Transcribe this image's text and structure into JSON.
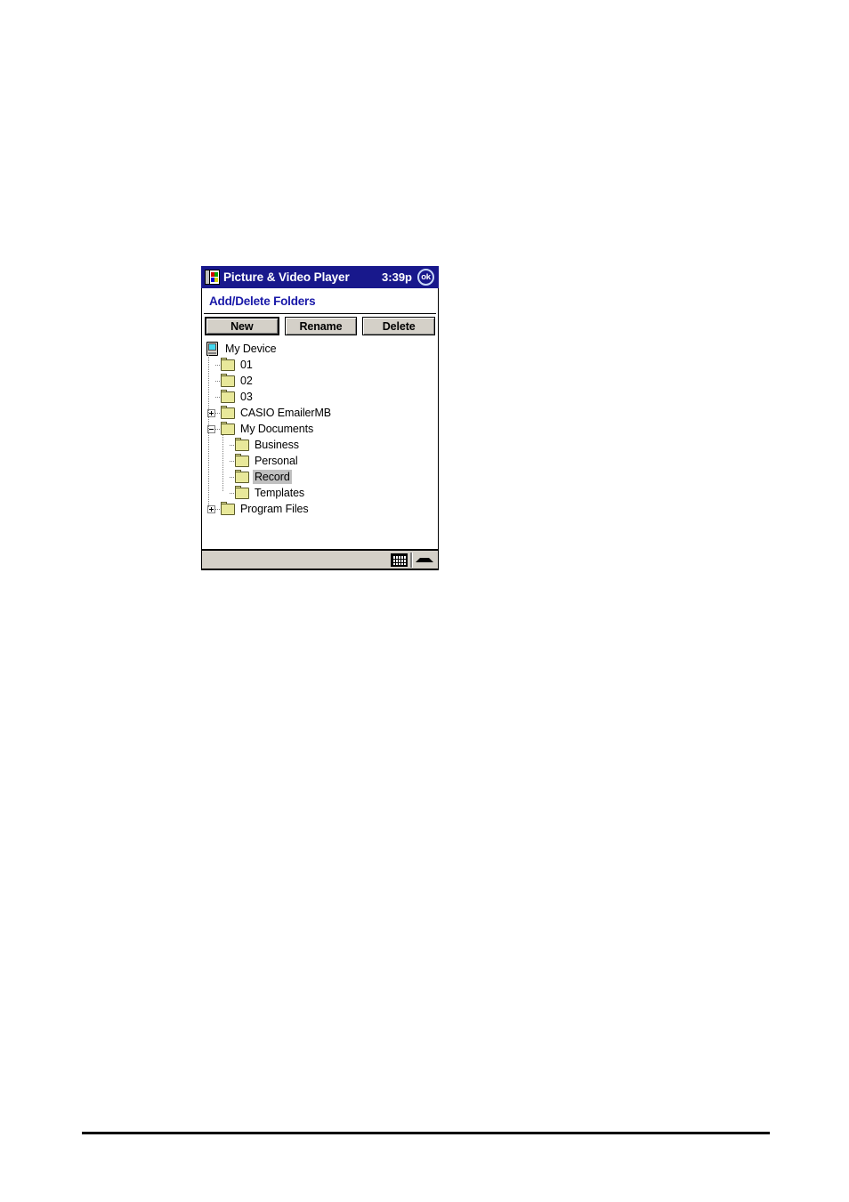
{
  "window": {
    "title": "Picture & Video Player",
    "clock": "3:39p",
    "ok_label": "ok",
    "app_icon": "picture-video-player-icon"
  },
  "page": {
    "heading": "Add/Delete Folders"
  },
  "toolbar": {
    "buttons": [
      {
        "label": "New",
        "default": true
      },
      {
        "label": "Rename",
        "default": false
      },
      {
        "label": "Delete",
        "default": false
      }
    ]
  },
  "tree": {
    "rows": [
      {
        "label": "My Device",
        "icon": "device-icon",
        "level": 0,
        "expander": "none",
        "selected": false
      },
      {
        "label": "01",
        "icon": "folder-icon",
        "level": 1,
        "expander": "none",
        "selected": false
      },
      {
        "label": "02",
        "icon": "folder-icon",
        "level": 1,
        "expander": "none",
        "selected": false
      },
      {
        "label": "03",
        "icon": "folder-icon",
        "level": 1,
        "expander": "none",
        "selected": false
      },
      {
        "label": "CASIO EmailerMB",
        "icon": "folder-icon",
        "level": 1,
        "expander": "plus",
        "selected": false
      },
      {
        "label": "My Documents",
        "icon": "folder-icon",
        "level": 1,
        "expander": "minus",
        "selected": false
      },
      {
        "label": "Business",
        "icon": "folder-icon",
        "level": 2,
        "expander": "none",
        "selected": false
      },
      {
        "label": "Personal",
        "icon": "folder-icon",
        "level": 2,
        "expander": "none",
        "selected": false
      },
      {
        "label": "Record",
        "icon": "folder-icon",
        "level": 2,
        "expander": "none",
        "selected": true
      },
      {
        "label": "Templates",
        "icon": "folder-icon",
        "level": 2,
        "expander": "none",
        "selected": false
      },
      {
        "label": "Program Files",
        "icon": "folder-icon",
        "level": 1,
        "expander": "plus",
        "selected": false
      }
    ]
  },
  "taskbar": {
    "sip_icon": "keyboard-icon",
    "sip_arrow_icon": "chevron-up-icon"
  },
  "colors": {
    "titlebar_bg": "#18188c",
    "heading_text": "#1919a8",
    "button_face": "#d4d0c8",
    "selection_bg": "#c0c0c0",
    "folder_fill": "#e8e89a",
    "device_screen": "#44d8f0"
  }
}
